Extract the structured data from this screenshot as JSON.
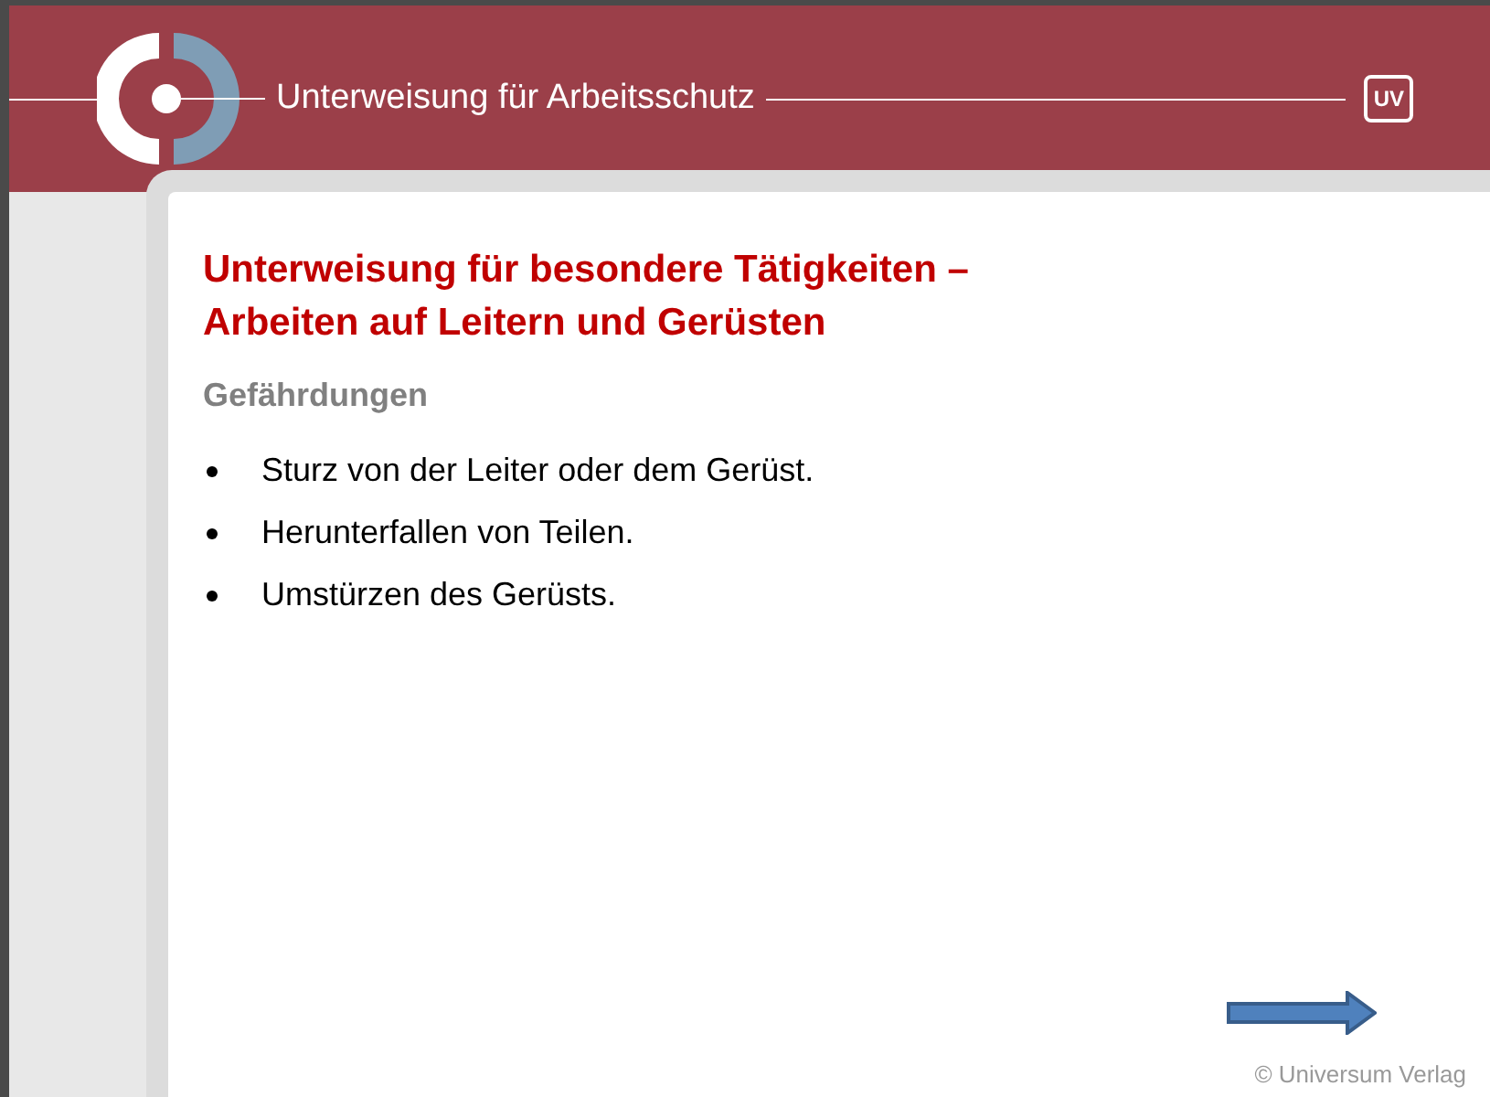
{
  "header": {
    "title": "Unterweisung für Arbeitsschutz",
    "badge": "UV"
  },
  "slide": {
    "title_lines": [
      "Unterweisung für besondere Tätigkeiten –",
      "Arbeiten auf Leitern und Gerüsten"
    ],
    "subtitle": "Gefährdungen",
    "bullets": [
      "Sturz von der Leiter oder dem Gerüst.",
      "Herunterfallen von Teilen.",
      "Umstürzen des Gerüsts."
    ],
    "copyright": "© Universum Verlag"
  }
}
